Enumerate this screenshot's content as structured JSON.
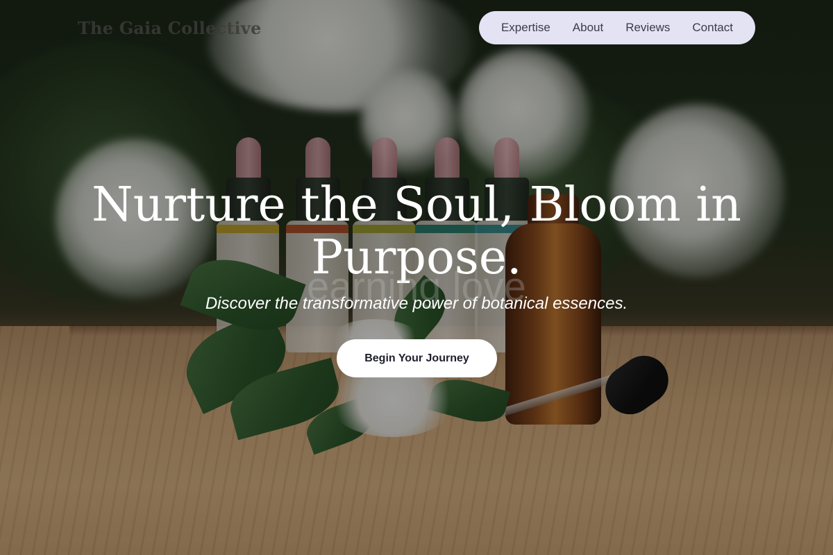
{
  "header": {
    "site_title": "The Gaia Collective"
  },
  "nav": {
    "items": [
      {
        "label": "Expertise"
      },
      {
        "label": "About"
      },
      {
        "label": "Reviews"
      },
      {
        "label": "Contact"
      }
    ]
  },
  "hero": {
    "headline": "Nurture the Soul, Bloom in Purpose.",
    "ghost_text": "earning love",
    "subline": "Discover the transformative power of botanical essences.",
    "cta_label": "Begin Your Journey"
  },
  "colors": {
    "nav_background": "#e3e3f4",
    "cta_background": "#ffffff",
    "text_light": "#ffffff"
  }
}
